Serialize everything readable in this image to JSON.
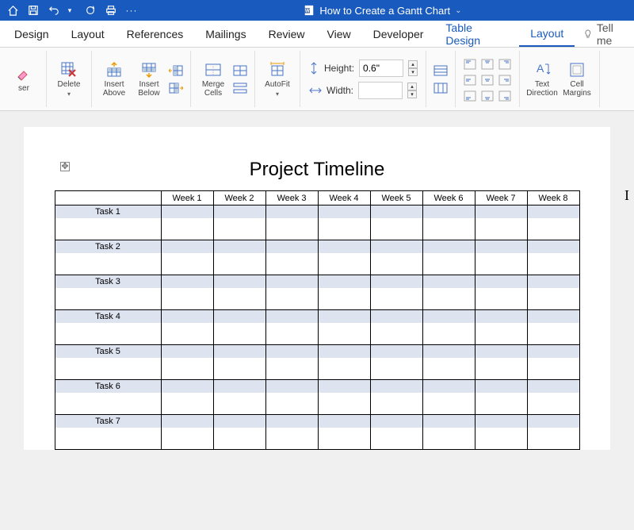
{
  "titlebar": {
    "title": "How to Create a Gantt Chart"
  },
  "tabs": {
    "design": "Design",
    "layout_page": "Layout",
    "references": "References",
    "mailings": "Mailings",
    "review": "Review",
    "view": "View",
    "developer": "Developer",
    "table_design": "Table Design",
    "layout_table": "Layout",
    "tellme": "Tell me"
  },
  "ribbon": {
    "eraser": "ser",
    "delete": "Delete",
    "insert_above": "Insert Above",
    "insert_below": "Insert Below",
    "merge_cells": "Merge Cells",
    "autofit": "AutoFit",
    "height_label": "Height:",
    "height_value": "0.6\"",
    "width_label": "Width:",
    "width_value": "",
    "text_direction": "Text Direction",
    "cell_margins": "Cell Margins"
  },
  "document": {
    "heading": "Project Timeline",
    "columns": [
      "Week 1",
      "Week 2",
      "Week 3",
      "Week 4",
      "Week 5",
      "Week 6",
      "Week 7",
      "Week 8"
    ],
    "rows": [
      "Task 1",
      "Task 2",
      "Task 3",
      "Task 4",
      "Task 5",
      "Task 6",
      "Task 7"
    ]
  }
}
